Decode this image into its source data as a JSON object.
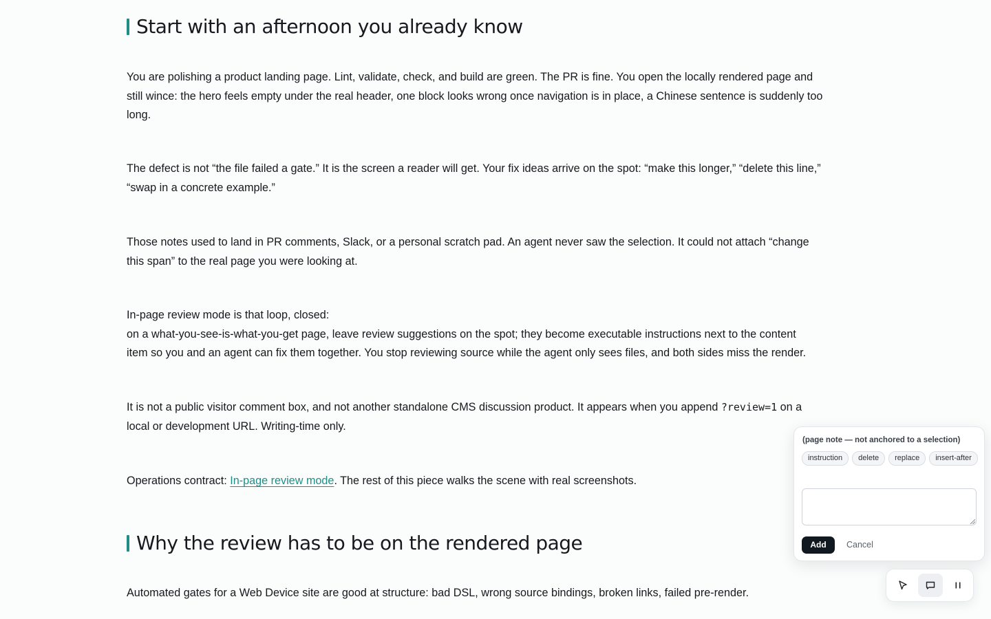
{
  "article": {
    "heading_1": "Start with an afternoon you already know",
    "paragraphs": [
      {
        "lines": [
          "You are polishing a product landing page. Lint, validate, check, and build are green. The PR is fine. You open the locally rendered page and",
          "still wince: the hero feels empty under the real header, one block looks wrong once navigation is in place, a Chinese sentence is suddenly too",
          "long."
        ]
      },
      {
        "lines": [
          "The defect is not “the file failed a gate.” It is the screen a reader will get. Your fix ideas arrive on the spot: “make this longer,” “delete this line,”",
          "“swap in a concrete example.”"
        ]
      },
      {
        "lines": [
          "Those notes used to land in PR comments, Slack, or a personal scratch pad. An agent never saw the selection. It could not attach “change",
          "this span” to the real page you were looking at."
        ]
      },
      {
        "lines": [
          "In-page review mode is that loop, closed:",
          "on a what-you-see-is-what-you-get page, leave review suggestions on the spot; they become executable instructions next to the content",
          "item so you and an agent can fix them together. You stop reviewing source while the agent only sees files, and both sides miss the render."
        ]
      },
      {
        "line1_before": "It is not a public visitor comment box, and not another standalone CMS discussion product. It appears when you append ",
        "code": "?review=1",
        "line1_after": " on a",
        "line2": "local or development URL. Writing-time only."
      },
      {
        "before": "Operations contract: ",
        "link": "In-page review mode",
        "after": ". The rest of this piece walks the scene with real screenshots."
      }
    ],
    "heading_2": "Why the review has to be on the rendered page",
    "last_paragraph": "Automated gates for a Web Device site are good at structure: bad DSL, wrong source bindings, broken links, failed pre-render."
  },
  "review_popover": {
    "note_title": "(page note — not anchored to a selection)",
    "chips": [
      "instruction",
      "delete",
      "replace",
      "insert-after"
    ],
    "input_value": "",
    "add_label": "Add",
    "cancel_label": "Cancel"
  },
  "toolbar": {
    "tools": [
      {
        "icon": "pointer-icon",
        "active": false
      },
      {
        "icon": "comment-icon",
        "active": true
      },
      {
        "icon": "pause-icon",
        "active": false
      }
    ]
  },
  "colors": {
    "accent": "#1f8f86",
    "text": "#16191d",
    "background": "#fbfcfc",
    "button_dark": "#111820"
  }
}
